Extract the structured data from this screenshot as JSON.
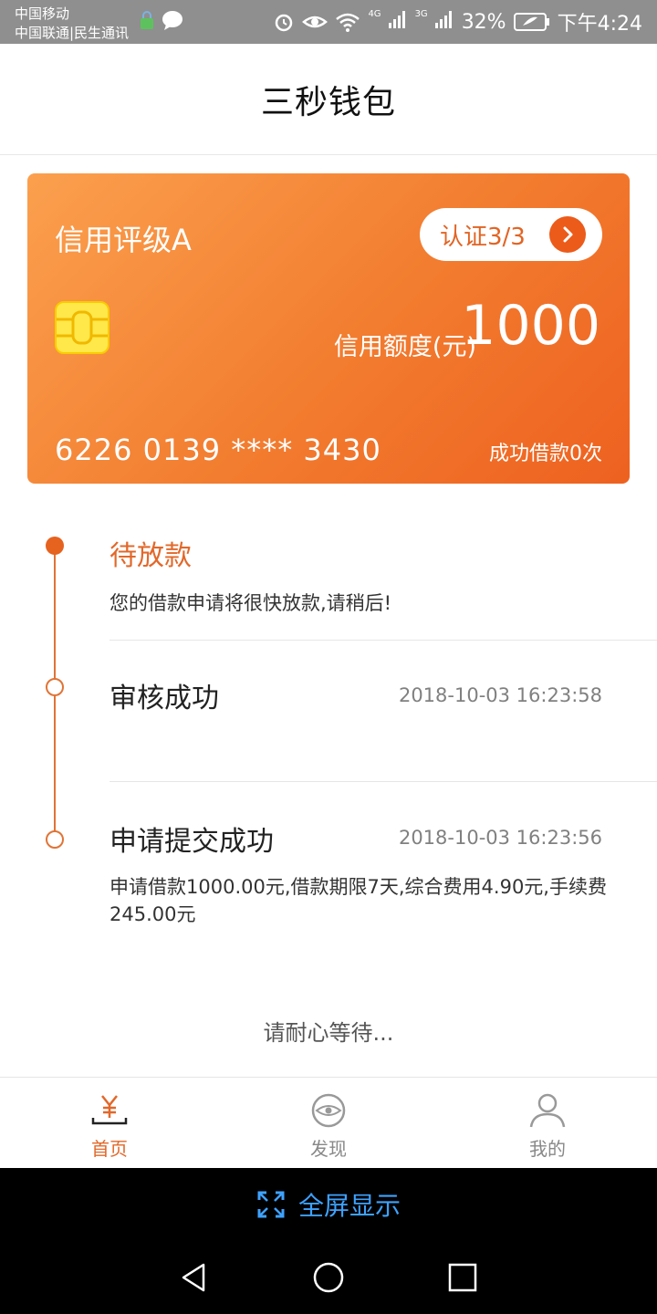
{
  "status_bar": {
    "carrier1": "中国移动",
    "carrier2": "中国联通|民生通讯",
    "net1": "4G",
    "net2": "3G",
    "battery": "32%",
    "time": "下午4:24"
  },
  "header": {
    "title": "三秒钱包"
  },
  "card": {
    "rating": "信用评级A",
    "cert_label": "认证3/3",
    "limit_label": "信用额度(元)",
    "limit_value": "1000",
    "card_number": "6226 0139 **** 3430",
    "loan_count": "成功借款0次"
  },
  "timeline": {
    "steps": [
      {
        "title": "待放款",
        "desc": "您的借款申请将很快放款,请稍后!"
      },
      {
        "title": "审核成功",
        "time": "2018-10-03 16:23:58"
      },
      {
        "title": "申请提交成功",
        "time": "2018-10-03 16:23:56",
        "desc": "申请借款1000.00元,借款期限7天,综合费用4.90元,手续费245.00元"
      }
    ]
  },
  "wait_text": "请耐心等待...",
  "bottom_nav": {
    "items": [
      {
        "label": "首页",
        "icon": "yen-icon"
      },
      {
        "label": "发现",
        "icon": "eye-icon"
      },
      {
        "label": "我的",
        "icon": "person-icon"
      }
    ]
  },
  "fullscreen": {
    "label": "全屏显示"
  },
  "colors": {
    "accent": "#e2682a",
    "card_start": "#fba04e",
    "card_end": "#ee6120",
    "link_blue": "#3ea2ff"
  }
}
